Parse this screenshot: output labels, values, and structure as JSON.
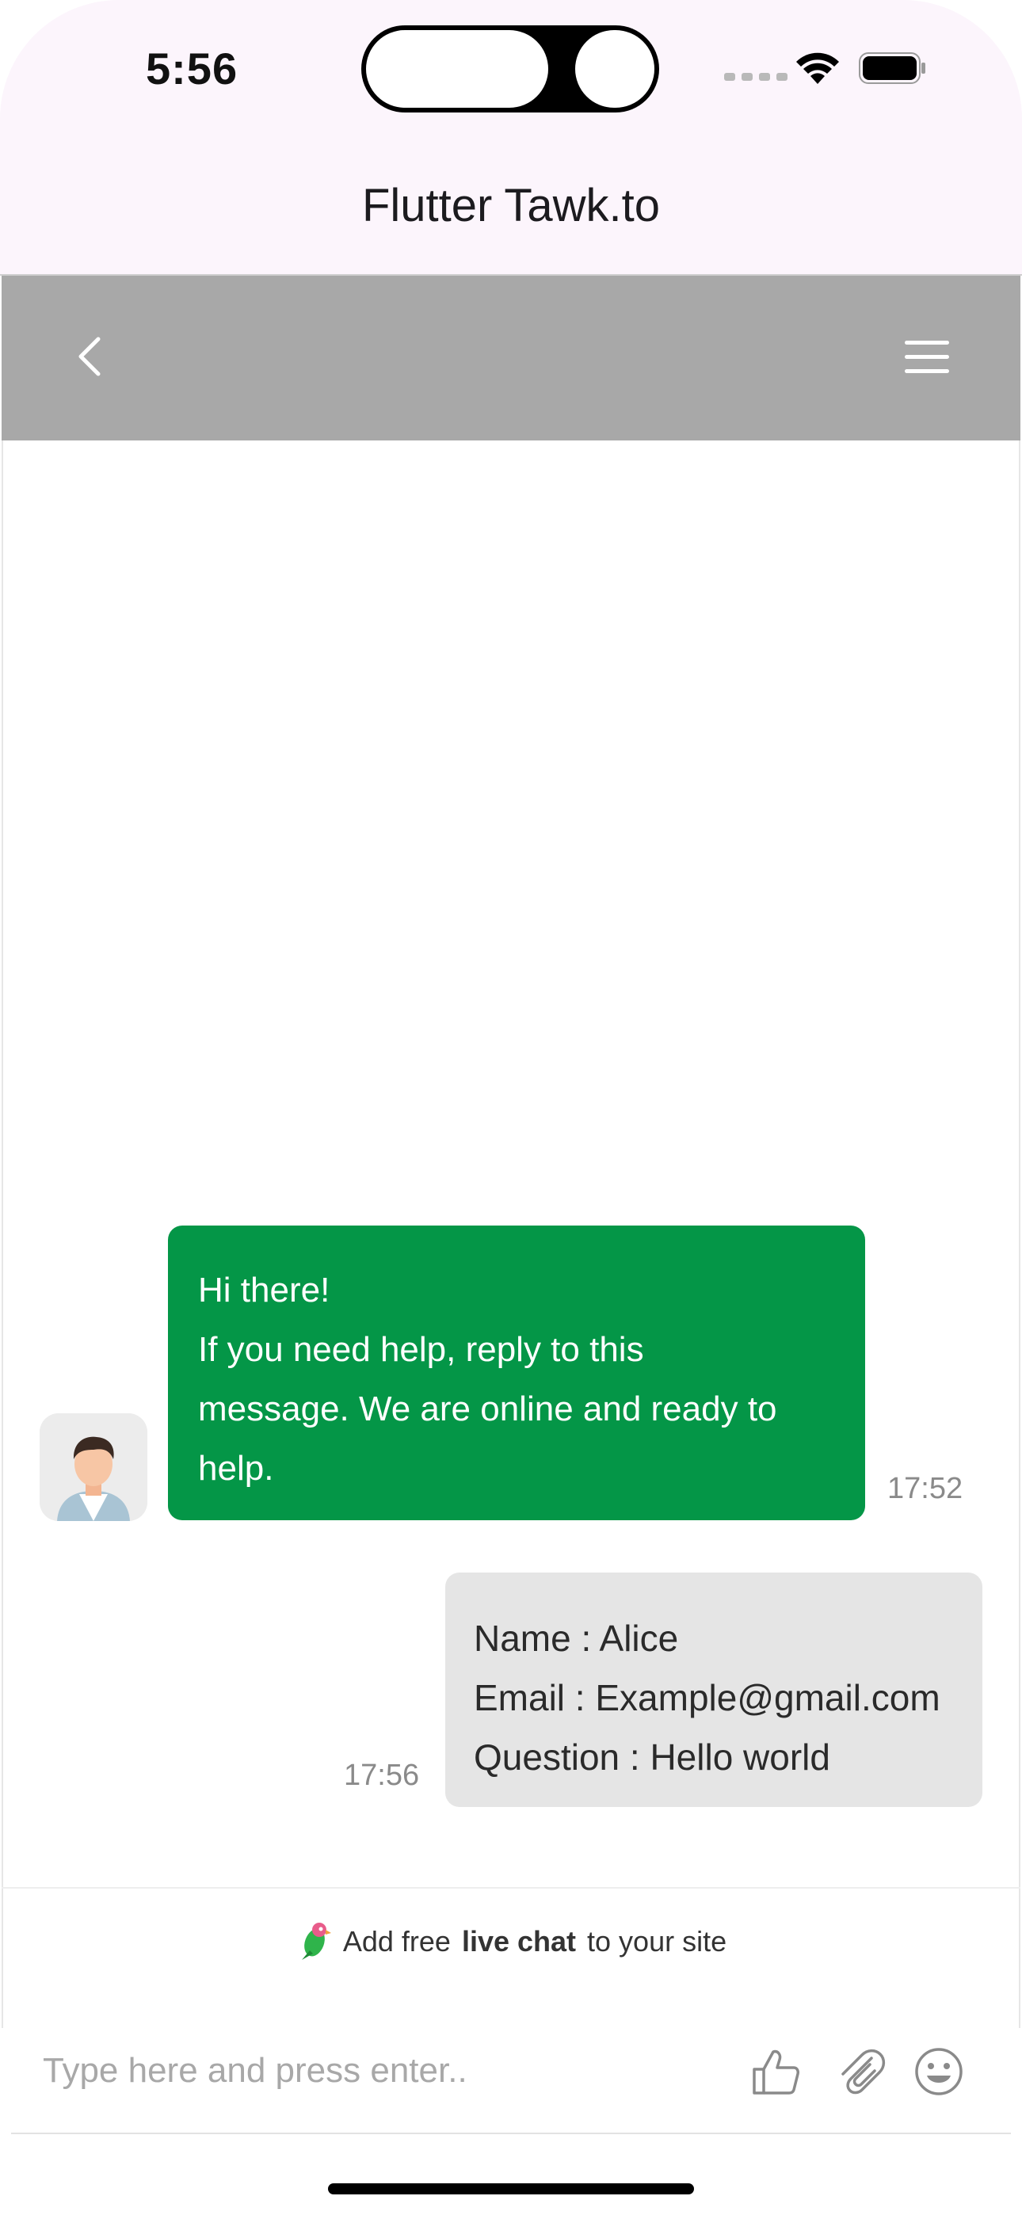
{
  "status_bar": {
    "time": "5:56"
  },
  "app_bar": {
    "title": "Flutter Tawk.to"
  },
  "chat_header": {
    "back_icon": "chevron-left-icon",
    "menu_icon": "hamburger-menu-icon",
    "background": "#a8a8a8"
  },
  "messages": [
    {
      "sender": "agent",
      "lines": [
        "Hi there!",
        "If you need help, reply to this",
        "message. We are online and ready to",
        "help."
      ],
      "time": "17:52",
      "color": "#049647"
    },
    {
      "sender": "visitor",
      "lines": [
        "Name : Alice",
        "Email : Example@gmail.com",
        "Question : Hello world"
      ],
      "time": "17:56",
      "color": "#e5e5e5"
    }
  ],
  "branding": {
    "prefix": "Add free",
    "bold": "live chat",
    "suffix": "to your site"
  },
  "composer": {
    "placeholder": "Type here and press enter..",
    "value": ""
  }
}
